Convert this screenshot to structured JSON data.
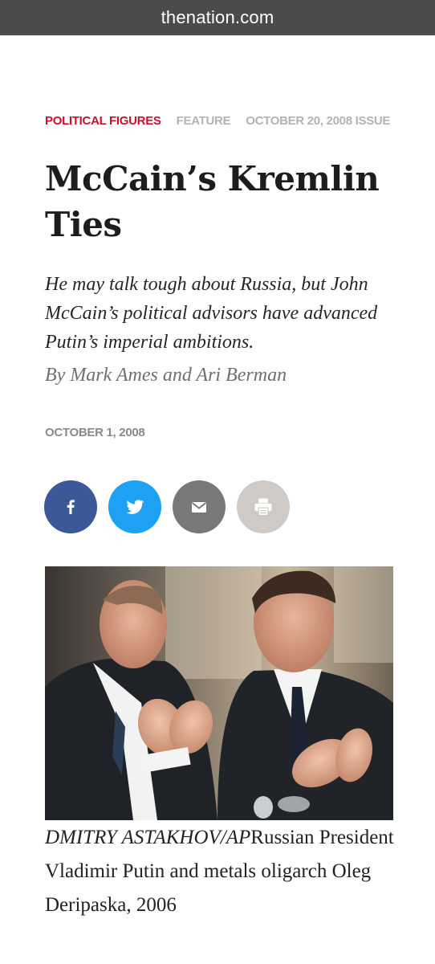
{
  "browser": {
    "url": "thenation.com"
  },
  "article": {
    "category": "POLITICAL FIGURES",
    "type": "FEATURE",
    "issue": "OCTOBER 20, 2008 ISSUE",
    "headline": "McCain’s Kremlin Ties",
    "dek": "He may talk tough about Russia, but John McCain’s political advisors have advanced Putin’s imperial ambitions.",
    "byline": "By Mark Ames and Ari Berman",
    "date": "OCTOBER 1, 2008"
  },
  "share": [
    {
      "icon": "facebook-icon",
      "color": "#3b5998"
    },
    {
      "icon": "twitter-icon",
      "color": "#1da1f2"
    },
    {
      "icon": "email-icon",
      "color": "#7a7876"
    },
    {
      "icon": "print-icon",
      "color": "#cfcac5"
    }
  ],
  "photo": {
    "credit": "DMITRY ASTAKHOV/AP",
    "caption": "Russian President Vladimir Putin and metals oligarch Oleg Deripaska, 2006"
  },
  "colors": {
    "accent": "#c8102e",
    "urlbar": "#4b4b4b"
  }
}
